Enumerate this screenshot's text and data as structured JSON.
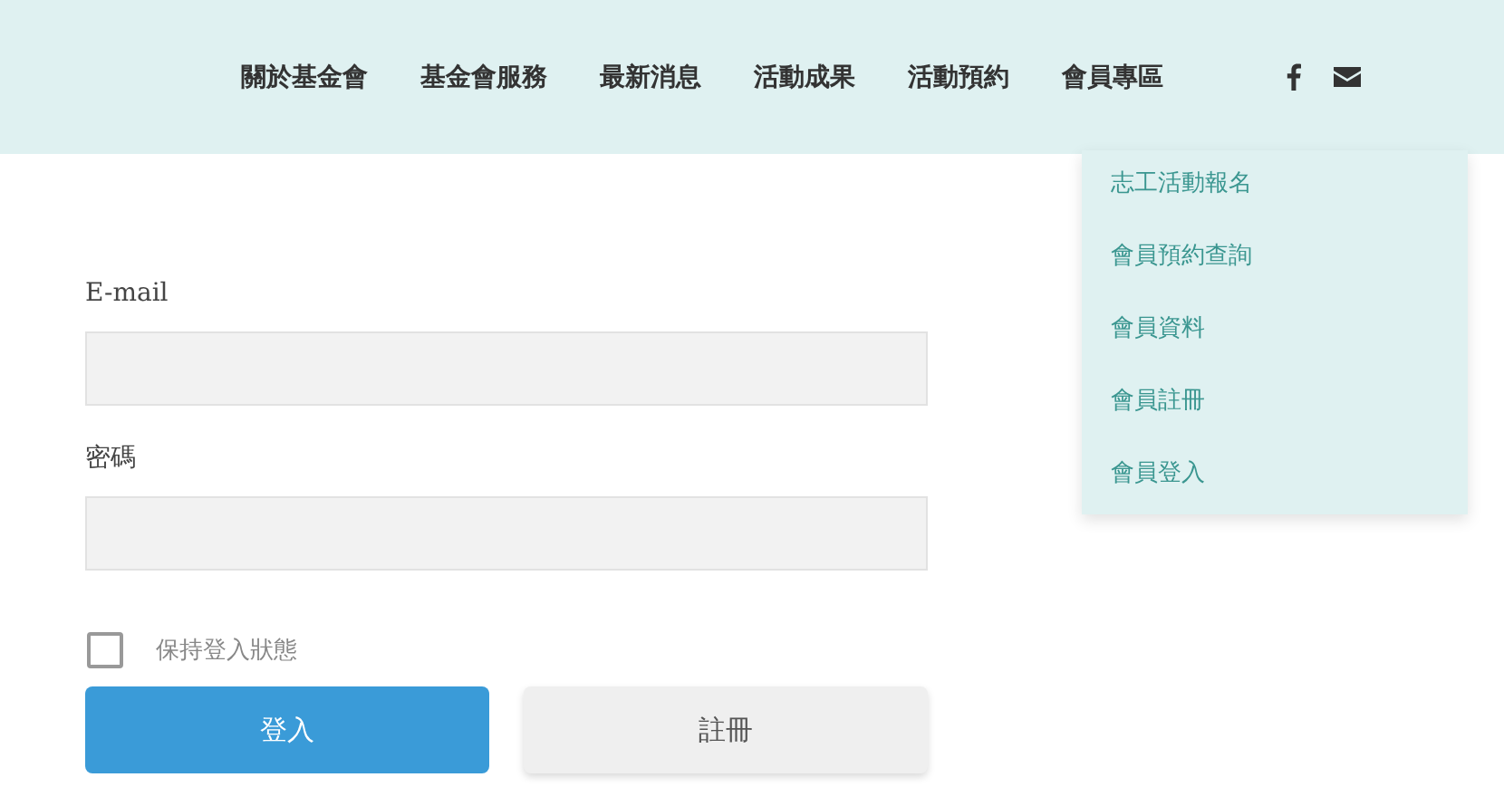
{
  "nav": {
    "items": [
      {
        "label": "關於基金會"
      },
      {
        "label": "基金會服務"
      },
      {
        "label": "最新消息"
      },
      {
        "label": "活動成果"
      },
      {
        "label": "活動預約"
      },
      {
        "label": "會員專區"
      }
    ]
  },
  "dropdown": {
    "items": [
      {
        "label": "志工活動報名"
      },
      {
        "label": "會員預約查詢"
      },
      {
        "label": "會員資料"
      },
      {
        "label": "會員註冊"
      },
      {
        "label": "會員登入"
      }
    ]
  },
  "form": {
    "fields": [
      {
        "label": "E-mail"
      },
      {
        "label": "密碼"
      }
    ],
    "remember": {
      "label": "保持登入狀態",
      "checked": false
    },
    "buttons": [
      {
        "label": "登入",
        "kind": "primary"
      },
      {
        "label": "註冊",
        "kind": "secondary"
      }
    ]
  }
}
